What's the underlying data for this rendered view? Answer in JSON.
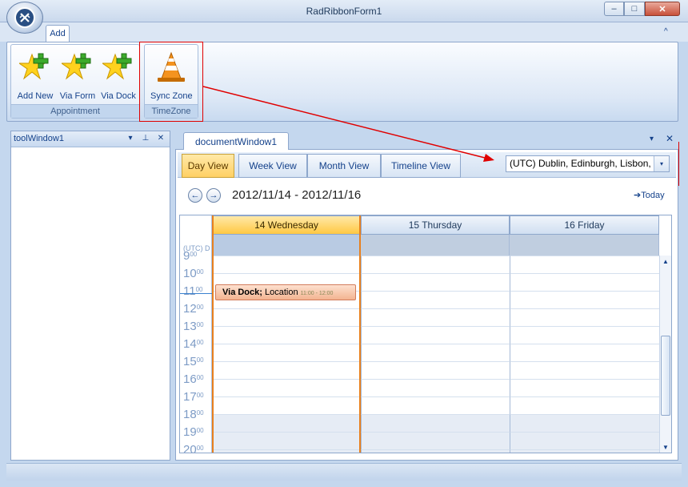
{
  "window": {
    "title": "RadRibbonForm1",
    "minimize": "–",
    "maximize": "□",
    "close": "✕"
  },
  "ribbon": {
    "tabs": [
      {
        "label": "Add"
      }
    ],
    "collapse_glyph": "^",
    "groups": [
      {
        "label": "Appointment",
        "buttons": [
          {
            "label": "Add New"
          },
          {
            "label": "Via Form"
          },
          {
            "label": "Via Dock"
          }
        ]
      },
      {
        "label": "TimeZone",
        "buttons": [
          {
            "label": "Sync Zone"
          }
        ]
      }
    ]
  },
  "tool_window": {
    "title": "toolWindow1",
    "menu_glyph": "▾",
    "pin_glyph": "⊥",
    "close_glyph": "✕"
  },
  "document": {
    "tab_title": "documentWindow1",
    "menu_glyph": "▾",
    "close_glyph": "✕"
  },
  "scheduler": {
    "view_tabs": [
      {
        "label": "Day View",
        "active": true
      },
      {
        "label": "Week View"
      },
      {
        "label": "Month View"
      },
      {
        "label": "Timeline View"
      }
    ],
    "timezone": {
      "selected": "(UTC) Dublin, Edinburgh, Lisbon, L",
      "arrow_glyph": "▾"
    },
    "nav": {
      "prev_glyph": "←",
      "next_glyph": "→",
      "date_range": "2012/11/14 - 2012/11/16",
      "today_label": "Today",
      "today_glyph": "➔"
    },
    "tz_caption": "(UTC) D",
    "days": [
      {
        "label": "14 Wednesday",
        "today": true
      },
      {
        "label": "15 Thursday"
      },
      {
        "label": "16 Friday"
      }
    ],
    "hours": [
      "9",
      "10",
      "11",
      "12",
      "13",
      "14",
      "15",
      "16",
      "17",
      "18",
      "19",
      "20"
    ],
    "minutes_sup": "00",
    "appointment": {
      "subject": "Via Dock;",
      "location": "Location",
      "time": "11:00 - 12:00",
      "day_index": 0
    },
    "colors": {
      "today_header": "#ffc843",
      "appointment": "#f3b491",
      "selection_accent": "#e8801e"
    }
  }
}
